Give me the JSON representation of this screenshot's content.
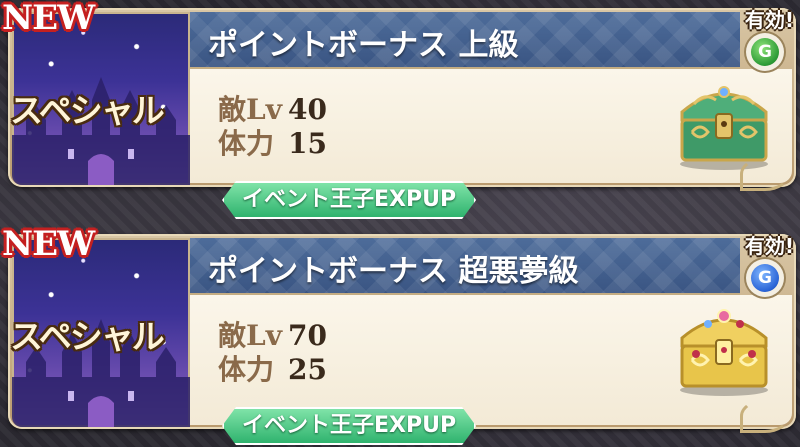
{
  "cards": [
    {
      "badge": "NEW",
      "type_label": "スペシャル",
      "title": "ポイントボーナス 上級",
      "enemy_level_label": "敵Lv",
      "enemy_level": "40",
      "stamina_label": "体力",
      "stamina": "15",
      "bonus_label": "イベント王子EXPUP",
      "valid_label": "有効!",
      "gem_letter": "G",
      "gem_color": "#2b9a35",
      "chest_icon": "green-treasure-chest"
    },
    {
      "badge": "NEW",
      "type_label": "スペシャル",
      "title": "ポイントボーナス 超悪夢級",
      "enemy_level_label": "敵Lv",
      "enemy_level": "70",
      "stamina_label": "体力",
      "stamina": "25",
      "bonus_label": "イベント王子EXPUP",
      "valid_label": "有効!",
      "gem_letter": "G",
      "gem_color": "#2a64d6",
      "chest_icon": "gold-treasure-chest"
    }
  ]
}
